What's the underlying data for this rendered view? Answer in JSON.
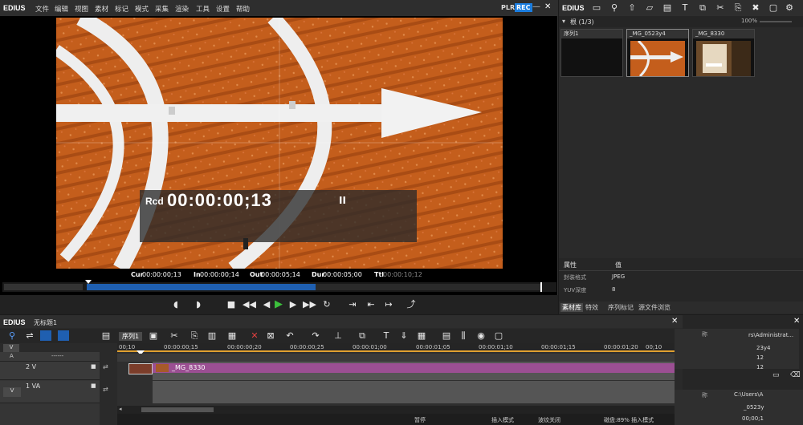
{
  "menubar": {
    "logo": "EDIUS",
    "items": [
      "文件",
      "编辑",
      "视图",
      "素材",
      "标记",
      "模式",
      "采集",
      "渲染",
      "工具",
      "设置",
      "帮助"
    ],
    "plr": "PLR",
    "rec": "REC"
  },
  "player": {
    "rcd_label": "Rcd",
    "rcd_timecode": "00:00:00;13",
    "pause_symbol": "II",
    "cur_label": "Cur",
    "cur_value": "00:00:00;13",
    "in_label": "In",
    "in_value": "00:00:00;14",
    "out_label": "Out",
    "out_value": "00:00:05;14",
    "dur_label": "Dur",
    "dur_value": "00:00:05;00",
    "ttl_label": "Ttl",
    "ttl_value": "00:00:10;12"
  },
  "bin": {
    "root_label": "根 (1/3)",
    "zoom": "100%",
    "clips": [
      {
        "label": "序列1"
      },
      {
        "label": "_MG_0523y4"
      },
      {
        "label": "_MG_8330"
      }
    ],
    "properties": {
      "header_name": "属性",
      "header_value": "值",
      "rows": [
        {
          "name": "封装格式",
          "value": "JPEG"
        },
        {
          "name": "YUV深度",
          "value": "8"
        }
      ]
    },
    "tabs": [
      "素材库",
      "特效",
      "序列标记",
      "源文件浏览"
    ]
  },
  "timeline": {
    "logo": "EDIUS",
    "project": "无标题1",
    "sequence_tab": "序列1",
    "ruler": [
      "00;10",
      "00:00:00;15",
      "00:00:00;20",
      "00:00:00;25",
      "00:00:01;00",
      "00:00:01;05",
      "00:00:01;10",
      "00:00:01;15",
      "00:00:01;20",
      "00;10"
    ],
    "tracks": {
      "v_label": "V",
      "a_label": "A",
      "dash_label": "------",
      "track_2v": "2 V",
      "track_1va_tag": "V",
      "track_1va": "1 VA"
    },
    "clip_name": "_MG_8330",
    "right_panel": {
      "name_label_1": "称",
      "path_1": "rs\\Administrat...",
      "item_1": "23y4",
      "val_1a": "12",
      "val_1b": "12",
      "name_label_2": "称",
      "path_2": "C:\\Users\\A",
      "item_2": "_0523y",
      "val_2": "00;00;1"
    },
    "status": [
      "暂停",
      "插入模式",
      "波纹关闭",
      "磁盘:89% 插入模式"
    ]
  },
  "colors": {
    "accent_blue": "#1f5fb0",
    "rec_blue": "#1a7de0",
    "play_green": "#3cbf3c",
    "clip_purple": "#9b4f93",
    "video_orange": "#c9631f"
  }
}
